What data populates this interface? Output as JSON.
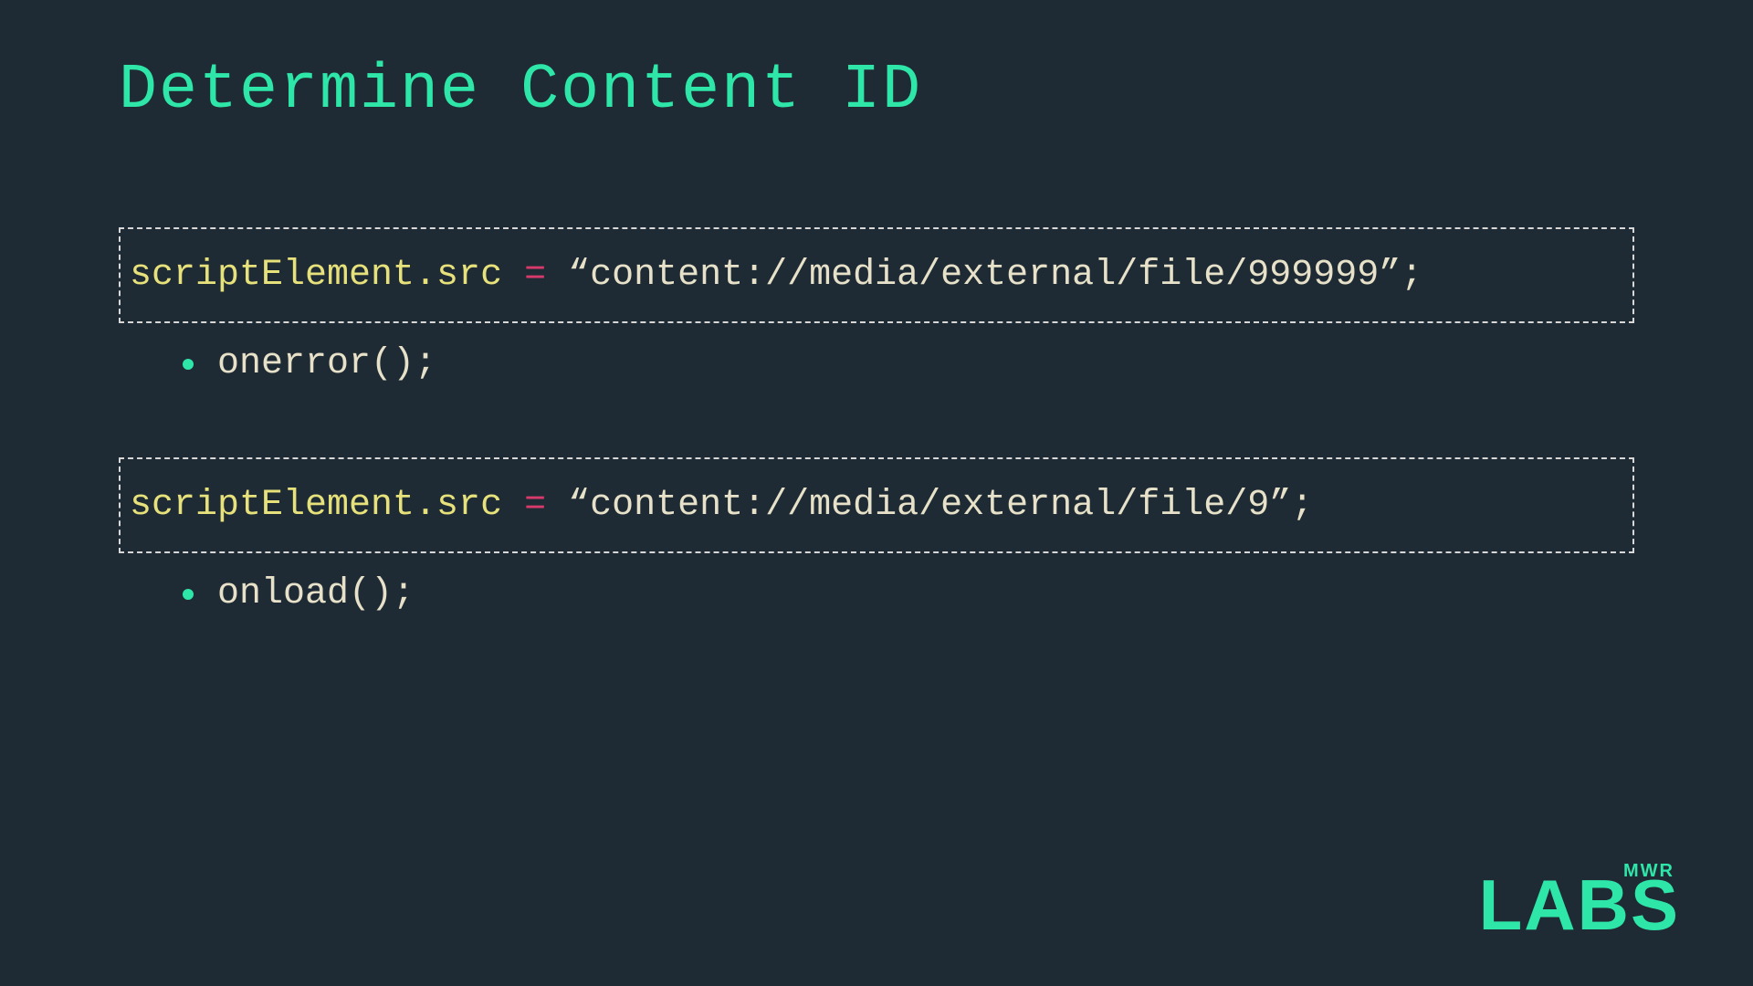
{
  "title": "Determine Content ID",
  "blocks": [
    {
      "code": {
        "obj": "scriptElement.src",
        "op": " = ",
        "str": "“content://media/external/file/999999”",
        "end": ";"
      },
      "bullet": "onerror();"
    },
    {
      "code": {
        "obj": "scriptElement.src",
        "op": " = ",
        "str": "“content://media/external/file/9”",
        "end": ";"
      },
      "bullet": "onload();"
    }
  ],
  "logo": {
    "top": "MWR",
    "bottom": "LABS"
  }
}
